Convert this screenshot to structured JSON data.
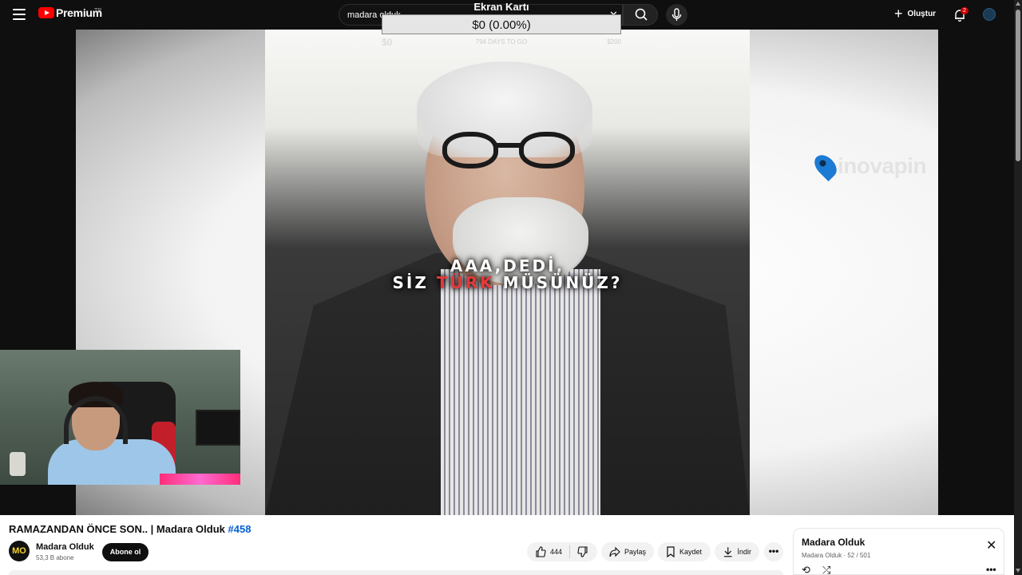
{
  "topbar": {
    "brand": "Premium",
    "country": "TR",
    "search_value": "madara olduk",
    "clear_glyph": "✕",
    "create_label": "Oluştur",
    "notification_count": "2",
    "icons": [
      "menu-icon",
      "youtube-logo-icon",
      "search-icon",
      "mic-icon",
      "plus-icon",
      "bell-icon",
      "avatar"
    ]
  },
  "overlay": {
    "title": "Ekran Kartı",
    "amount": "$0 (0.00%)",
    "left_value": "$0",
    "days_left": "794 DAYS TO GO",
    "goal": "$200"
  },
  "video": {
    "caption_line1": "AAA,DEDİ,",
    "caption_line2_pre": "SİZ ",
    "caption_line2_red": "TÜRK",
    "caption_line2_post": " MÜSÜNÜZ?",
    "watermark_text": "inovapin",
    "channel_logo": "MO",
    "accent_red": "#e23a3a"
  },
  "info": {
    "title": "RAMAZANDAN ÖNCE SON.. | Madara Olduk ",
    "hashtag": "#458",
    "channel_avatar": "MO",
    "channel_name": "Madara Olduk",
    "subscribers": "53,3 B abone",
    "subscribe_label": "Abone ol",
    "likes": "444",
    "share_label": "Paylaş",
    "save_label": "Kaydet",
    "download_label": "İndir",
    "more_glyph": "•••"
  },
  "playlist": {
    "title": "Madara Olduk",
    "owner": "Madara Olduk",
    "position": "52 / 501",
    "close_glyph": "✕",
    "loop_glyph": "⟲",
    "shuffle_glyph": "⤮",
    "more_glyph": "•••"
  }
}
